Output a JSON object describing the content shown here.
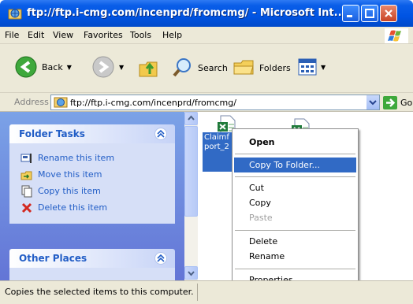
{
  "window": {
    "title": "ftp://ftp.i-cmg.com/incenprd/fromcmg/ - Microsoft Int..."
  },
  "menu": [
    "File",
    "Edit",
    "View",
    "Favorites",
    "Tools",
    "Help"
  ],
  "toolbar": {
    "back": "Back",
    "search": "Search",
    "folders": "Folders"
  },
  "address": {
    "label": "Address",
    "url": "ftp://ftp.i-cmg.com/incenprd/fromcmg/",
    "go": "Go"
  },
  "task_pane": {
    "folder_tasks": {
      "title": "Folder Tasks",
      "items": [
        {
          "label": "Rename this item",
          "icon": "rename-icon"
        },
        {
          "label": "Move this item",
          "icon": "move-icon"
        },
        {
          "label": "Copy this item",
          "icon": "copy-icon"
        },
        {
          "label": "Delete this item",
          "icon": "delete-icon"
        }
      ]
    },
    "other_places": {
      "title": "Other Places"
    }
  },
  "files": {
    "selected_label": "Claimf port_2 x"
  },
  "context_menu": {
    "items": [
      {
        "label": "Open",
        "style": "bold"
      },
      {
        "label": "Copy To Folder...",
        "style": "highlighted"
      },
      {
        "label": "Cut",
        "style": "normal"
      },
      {
        "label": "Copy",
        "style": "normal"
      },
      {
        "label": "Paste",
        "style": "disabled"
      },
      {
        "label": "Delete",
        "style": "normal"
      },
      {
        "label": "Rename",
        "style": "normal"
      },
      {
        "label": "Properties",
        "style": "normal"
      }
    ]
  },
  "status": {
    "text": "Copies the selected items to this computer."
  },
  "colors": {
    "titlebar": "#0054e3",
    "taskpane_link": "#215dc6",
    "highlight": "#316ac5"
  }
}
